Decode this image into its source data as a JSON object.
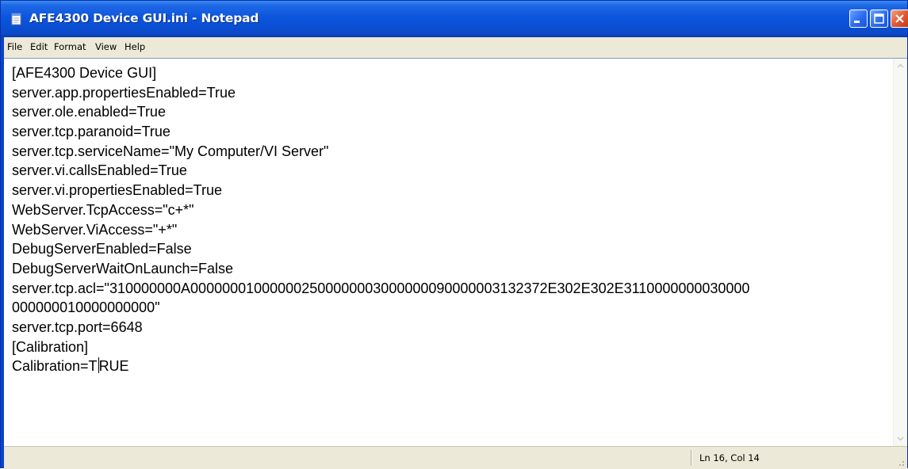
{
  "window": {
    "title": "AFE4300 Device GUI.ini - Notepad",
    "icon": "notepad-icon",
    "title_color": "#0a4fd4"
  },
  "menu": {
    "items": [
      "File",
      "Edit",
      "Format",
      "View",
      "Help"
    ]
  },
  "document": {
    "lines": [
      "[AFE4300 Device GUI]",
      "server.app.propertiesEnabled=True",
      "server.ole.enabled=True",
      "server.tcp.paranoid=True",
      "server.tcp.serviceName=\"My Computer/VI Server\"",
      "server.vi.callsEnabled=True",
      "server.vi.propertiesEnabled=True",
      "WebServer.TcpAccess=\"c+*\"",
      "WebServer.ViAccess=\"+*\"",
      "DebugServerEnabled=False",
      "DebugServerWaitOnLaunch=False",
      "server.tcp.acl=\"310000000A000000010000002500000003000000090000003132372E302E302E3110000000030000",
      "000000010000000000\"",
      "server.tcp.port=6648",
      "[Calibration]",
      "Calibration=TRUE"
    ],
    "caret_before": "Calibration=T",
    "caret_after": "RUE"
  },
  "status": {
    "position": "Ln 16, Col 14"
  }
}
